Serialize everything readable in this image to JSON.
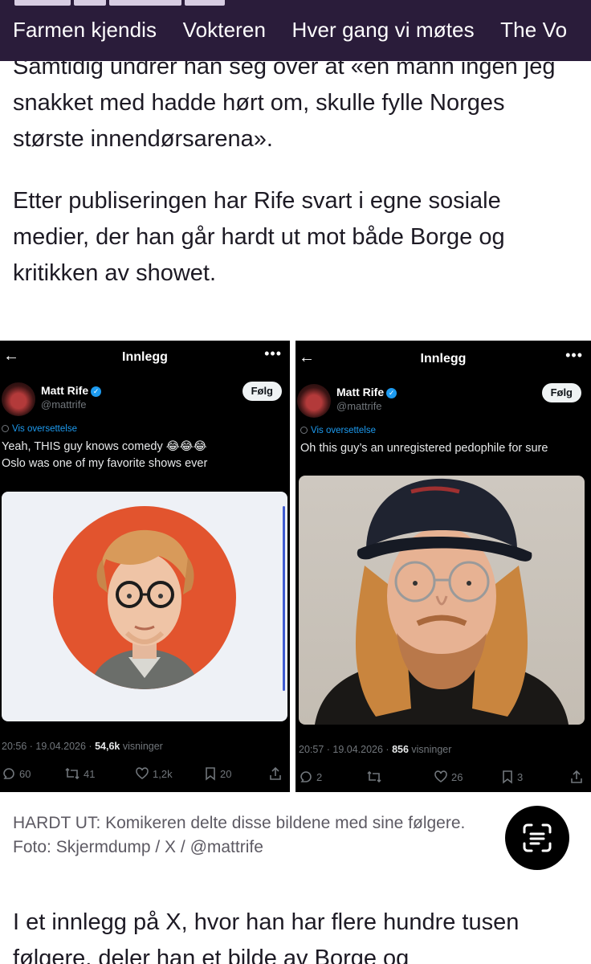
{
  "nav": {
    "items": [
      "Farmen kjendis",
      "Vokteren",
      "Hver gang vi møtes",
      "The Vo"
    ]
  },
  "article": {
    "para1": "Samtidig undrer han seg over at «en mann ingen jeg snakket med hadde hørt om, skulle fylle Norges største innendørsarena».",
    "para2": "Etter publiseringen har Rife svart i egne sosiale medier, der han går hardt ut mot både Borge og kritikken av showet.",
    "para3": "I et innlegg på X, hvor han har flere hundre tusen følgere, deler han et bilde av Borge og",
    "caption_line1": "HARDT UT: Komikeren delte disse bildene med sine følgere.",
    "caption_line2": "Foto: Skjermdump / X / @mattrife"
  },
  "tweets": [
    {
      "header_title": "Innlegg",
      "name": "Matt Rife",
      "handle": "@mattrife",
      "follow_label": "Følg",
      "translate_label": "Vis oversettelse",
      "text_line1": "Yeah, THIS guy knows comedy 😂😂😂",
      "text_line2": "Oslo was one of my favorite shows ever",
      "time": "20:56 · 19.04.2026 · ",
      "views_count": "54,6k",
      "views_label": " visninger",
      "replies": "60",
      "retweets": "41",
      "likes": "1,2k",
      "bookmarks": "20"
    },
    {
      "header_title": "Innlegg",
      "name": "Matt Rife",
      "handle": "@mattrife",
      "follow_label": "Følg",
      "translate_label": "Vis oversettelse",
      "text_line1": "Oh this guy’s an unregistered pedophile for sure",
      "time": "20:57 · 19.04.2026 · ",
      "views_count": "856",
      "views_label": " visninger",
      "replies": "2",
      "retweets": "",
      "likes": "26",
      "bookmarks": "3"
    }
  ],
  "icons": {
    "back": "arrow-left-icon",
    "more": "more-dots-icon",
    "verified": "verified-badge-icon",
    "reply": "reply-icon",
    "retweet": "retweet-icon",
    "like": "heart-icon",
    "bookmark": "bookmark-icon",
    "share": "share-icon",
    "scan": "text-scan-icon"
  },
  "colors": {
    "nav_bg": "#2a1c3a",
    "x_blue": "#1d9bf0",
    "x_gray": "#71767b",
    "photo_bg_orange": "#e2542e"
  }
}
